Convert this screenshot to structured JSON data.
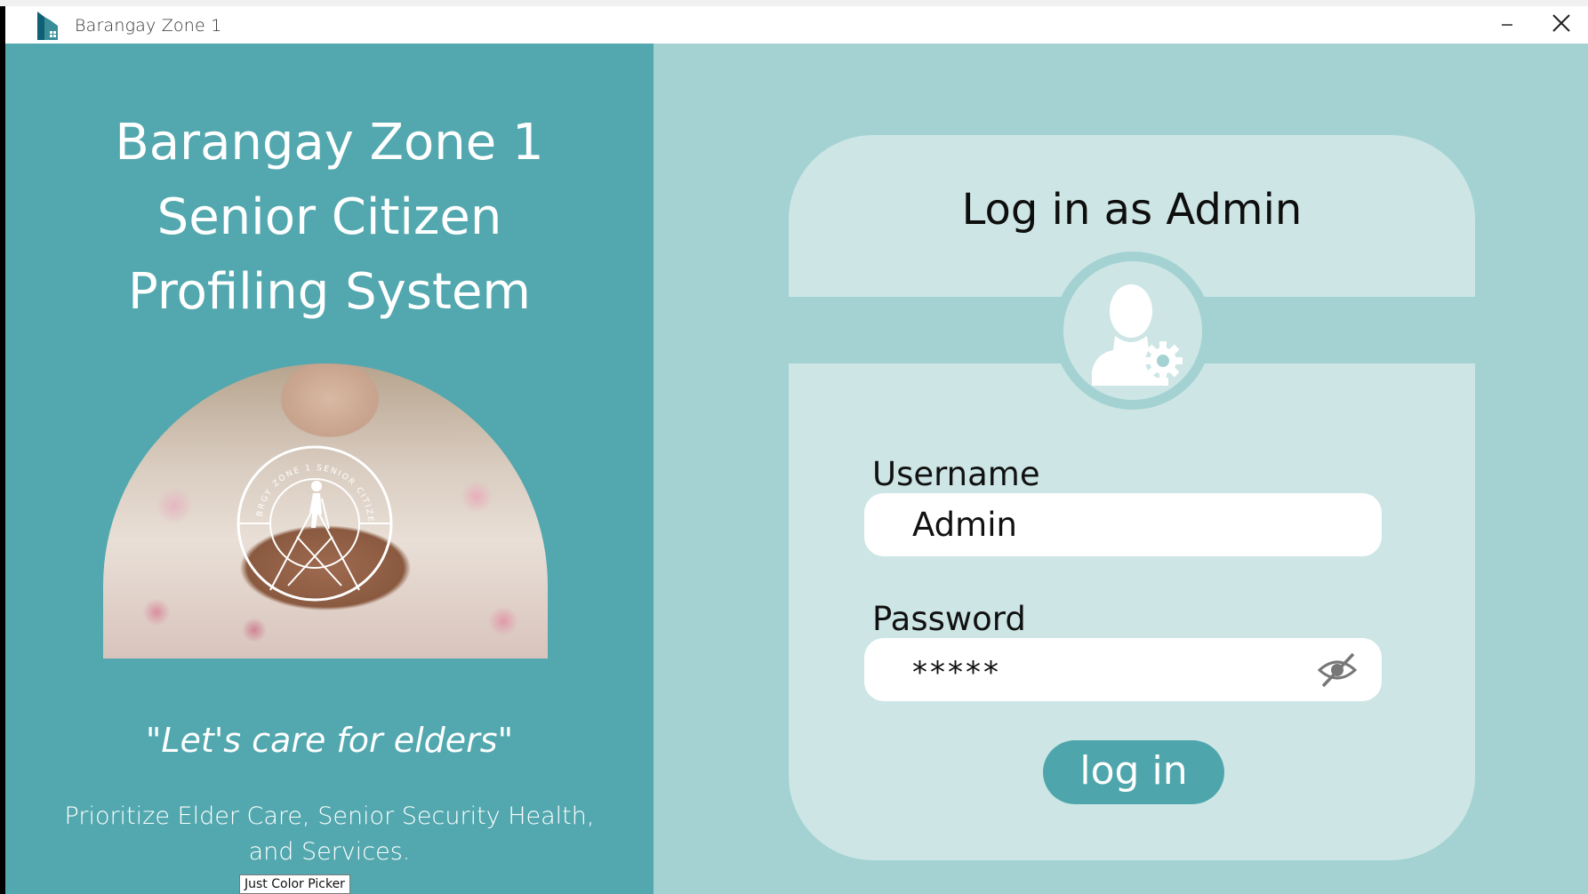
{
  "window": {
    "title": "Barangay Zone 1",
    "icon": "building-logo-icon",
    "controls": {
      "minimize_icon": "minimize-icon",
      "close_icon": "close-icon"
    }
  },
  "branding": {
    "heading_lines": [
      "Barangay Zone 1",
      "Senior Citizen",
      "Profiling System"
    ],
    "emblem_text": "BRGY ZONE 1 SENIOR CITIZEN",
    "tagline": "\"Let's care for elders\"",
    "mission_lines": [
      "Prioritize Elder Care, Senior Security Health,",
      "and Services."
    ]
  },
  "login": {
    "title": "Log in as Admin",
    "avatar_icon": "admin-user-gear-icon",
    "username": {
      "label": "Username",
      "value": "Admin"
    },
    "password": {
      "label": "Password",
      "value": "*****",
      "toggle_icon": "eye-slash-icon"
    },
    "submit_label": "log in"
  },
  "overlay": {
    "color_picker_tooltip": "Just Color Picker"
  },
  "colors": {
    "left_panel": "#52a8ae",
    "right_panel": "#a4d2d2",
    "card": "#cde6e5",
    "button": "#4ea6ac",
    "text_light": "#ffffff",
    "text_dark": "#111111"
  }
}
